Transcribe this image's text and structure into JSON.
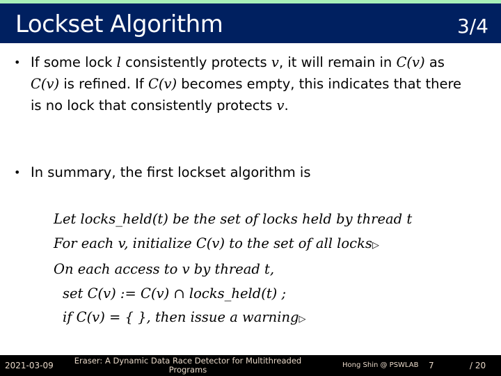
{
  "header": {
    "title": "Lockset Algorithm",
    "counter": "3/4"
  },
  "bullets": [
    {
      "marker": "•",
      "segments": {
        "s1": "If some lock ",
        "m1": "l",
        "s2": " consistently protects ",
        "m2": "v",
        "s3": ", it will remain in ",
        "m3": "C(v)",
        "s4": " as ",
        "m4": "C(v)",
        "s5": " is refined. If ",
        "m5": "C(v)",
        "s6": " becomes empty, this indicates that there is no lock that consistently protects ",
        "m6": "v",
        "s7": "."
      }
    },
    {
      "marker": "•",
      "text": "In summary, the first lockset algorithm is"
    }
  ],
  "algorithm": {
    "lines": [
      "Let locks_held(t) be the set of locks held by thread t",
      "For each v, initialize C(v) to the set of all locks",
      "On each access to v by thread t,",
      "set C(v) := C(v) ∩ locks_held(t) ;",
      "if C(v) = { }, then issue a warning"
    ],
    "end_marker": "▷"
  },
  "footer": {
    "date": "2021-03-09",
    "title": "Eraser: A Dynamic Data Race Detector for Multithreaded Programs",
    "author": "Hong Shin @ PSWLAB",
    "page": "7",
    "total": "/ 20"
  },
  "colors": {
    "title_bar": "#002060",
    "top_strip": "#a8f0b8",
    "footer_bg": "#000000"
  }
}
